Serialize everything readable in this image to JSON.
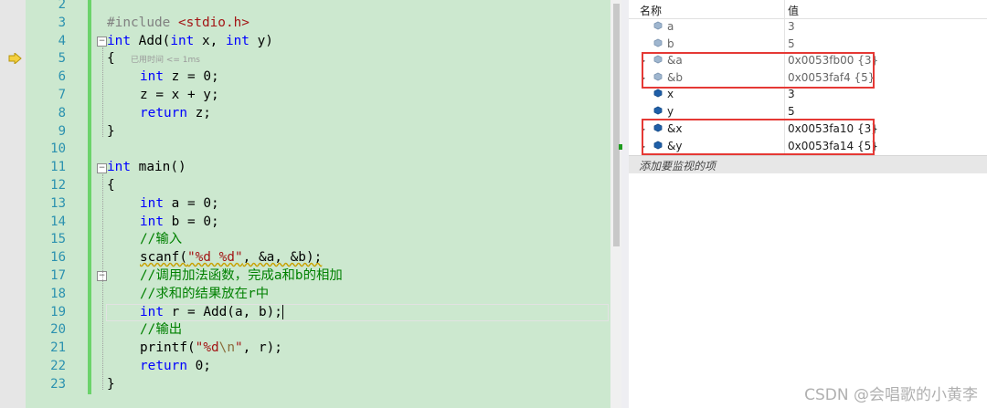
{
  "editor": {
    "line_numbers": [
      "2",
      "3",
      "4",
      "5",
      "6",
      "7",
      "8",
      "9",
      "10",
      "11",
      "12",
      "13",
      "14",
      "15",
      "16",
      "17",
      "18",
      "19",
      "20",
      "21",
      "22",
      "23"
    ],
    "lines": {
      "l3": {
        "pp": "#include ",
        "str": "<stdio.h>"
      },
      "l4": {
        "kw1": "int",
        "t1": " Add(",
        "kw2": "int",
        "t2": " x, ",
        "kw3": "int",
        "t3": " y)"
      },
      "l5": {
        "brace": "{",
        "hint": "已用时间 <= 1ms"
      },
      "l6": {
        "kw": "int",
        "t": " z = 0;"
      },
      "l7": {
        "t": "z = x + y;"
      },
      "l8": {
        "kw": "return",
        "t": " z;"
      },
      "l9": {
        "t": "}"
      },
      "l11": {
        "kw": "int",
        "t": " main()"
      },
      "l12": {
        "t": "{"
      },
      "l13": {
        "kw": "int",
        "t": " a = 0;"
      },
      "l14": {
        "kw": "int",
        "t": " b = 0;"
      },
      "l15": {
        "cm": "//输入"
      },
      "l16": {
        "fn": "scanf(",
        "str": "\"%d %d\"",
        "t": ", &a, &b);"
      },
      "l17": {
        "cm": "//调用加法函数，完成a和b的相加"
      },
      "l18": {
        "cm": "//求和的结果放在r中"
      },
      "l19": {
        "kw": "int",
        "t": " r = Add(a, b);"
      },
      "l20": {
        "cm": "//输出"
      },
      "l21": {
        "fn": "printf(",
        "str1": "\"%d",
        "esc": "\\n",
        "str2": "\"",
        "t": ", r);"
      },
      "l22": {
        "kw": "return",
        "t": " 0;"
      },
      "l23": {
        "t": "}"
      }
    },
    "fold_symbol": "−"
  },
  "watch": {
    "headers": {
      "name": "名称",
      "value": "值"
    },
    "rows": [
      {
        "name": "a",
        "value": "3",
        "expandable": false
      },
      {
        "name": "b",
        "value": "5",
        "expandable": false
      },
      {
        "name": "&a",
        "value": "0x0053fb00 {3}",
        "expandable": true
      },
      {
        "name": "&b",
        "value": "0x0053faf4 {5}",
        "expandable": true
      },
      {
        "name": "x",
        "value": "3",
        "expandable": false
      },
      {
        "name": "y",
        "value": "5",
        "expandable": false
      },
      {
        "name": "&x",
        "value": "0x0053fa10 {3}",
        "expandable": true
      },
      {
        "name": "&y",
        "value": "0x0053fa14 {5}",
        "expandable": true
      }
    ],
    "add_placeholder": "添加要监视的项",
    "expand_glyph": "▸",
    "colors": {
      "highlight_border": "#e53935",
      "editor_bg": "#cce8cf",
      "keyword": "#0000ff",
      "comment": "#008000",
      "string": "#a31515",
      "line_number": "#2b91af"
    }
  },
  "footer": {
    "watermark": "CSDN @会唱歌的小黄李"
  }
}
